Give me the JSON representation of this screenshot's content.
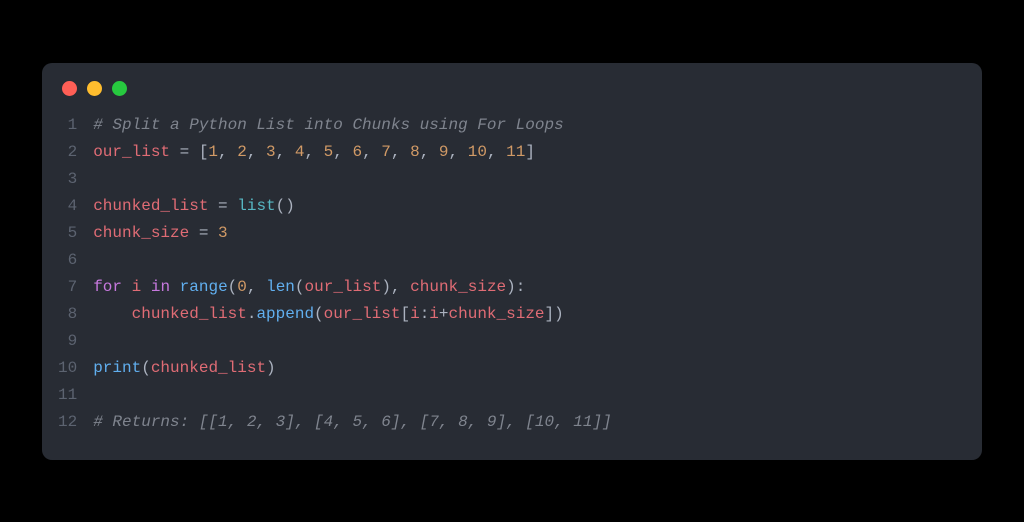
{
  "window": {
    "dots": [
      "red",
      "yellow",
      "green"
    ]
  },
  "code": {
    "line_numbers": [
      "1",
      "2",
      "3",
      "4",
      "5",
      "6",
      "7",
      "8",
      "9",
      "10",
      "11",
      "12"
    ],
    "lines": [
      [
        {
          "t": "# Split a Python List into Chunks using For Loops",
          "c": "c-comment"
        }
      ],
      [
        {
          "t": "our_list",
          "c": "c-id"
        },
        {
          "t": " = [",
          "c": "c-op"
        },
        {
          "t": "1",
          "c": "c-num"
        },
        {
          "t": ", ",
          "c": "c-punc"
        },
        {
          "t": "2",
          "c": "c-num"
        },
        {
          "t": ", ",
          "c": "c-punc"
        },
        {
          "t": "3",
          "c": "c-num"
        },
        {
          "t": ", ",
          "c": "c-punc"
        },
        {
          "t": "4",
          "c": "c-num"
        },
        {
          "t": ", ",
          "c": "c-punc"
        },
        {
          "t": "5",
          "c": "c-num"
        },
        {
          "t": ", ",
          "c": "c-punc"
        },
        {
          "t": "6",
          "c": "c-num"
        },
        {
          "t": ", ",
          "c": "c-punc"
        },
        {
          "t": "7",
          "c": "c-num"
        },
        {
          "t": ", ",
          "c": "c-punc"
        },
        {
          "t": "8",
          "c": "c-num"
        },
        {
          "t": ", ",
          "c": "c-punc"
        },
        {
          "t": "9",
          "c": "c-num"
        },
        {
          "t": ", ",
          "c": "c-punc"
        },
        {
          "t": "10",
          "c": "c-num"
        },
        {
          "t": ", ",
          "c": "c-punc"
        },
        {
          "t": "11",
          "c": "c-num"
        },
        {
          "t": "]",
          "c": "c-punc"
        }
      ],
      [],
      [
        {
          "t": "chunked_list",
          "c": "c-id"
        },
        {
          "t": " = ",
          "c": "c-op"
        },
        {
          "t": "list",
          "c": "c-builtin"
        },
        {
          "t": "()",
          "c": "c-punc"
        }
      ],
      [
        {
          "t": "chunk_size",
          "c": "c-id"
        },
        {
          "t": " = ",
          "c": "c-op"
        },
        {
          "t": "3",
          "c": "c-num"
        }
      ],
      [],
      [
        {
          "t": "for",
          "c": "c-kw"
        },
        {
          "t": " ",
          "c": ""
        },
        {
          "t": "i",
          "c": "c-id"
        },
        {
          "t": " ",
          "c": ""
        },
        {
          "t": "in",
          "c": "c-kw"
        },
        {
          "t": " ",
          "c": ""
        },
        {
          "t": "range",
          "c": "c-fn"
        },
        {
          "t": "(",
          "c": "c-punc"
        },
        {
          "t": "0",
          "c": "c-num"
        },
        {
          "t": ", ",
          "c": "c-punc"
        },
        {
          "t": "len",
          "c": "c-fn"
        },
        {
          "t": "(",
          "c": "c-punc"
        },
        {
          "t": "our_list",
          "c": "c-id"
        },
        {
          "t": "), ",
          "c": "c-punc"
        },
        {
          "t": "chunk_size",
          "c": "c-id"
        },
        {
          "t": "):",
          "c": "c-punc"
        }
      ],
      [
        {
          "t": "    ",
          "c": ""
        },
        {
          "t": "chunked_list",
          "c": "c-id"
        },
        {
          "t": ".",
          "c": "c-punc"
        },
        {
          "t": "append",
          "c": "c-fn"
        },
        {
          "t": "(",
          "c": "c-punc"
        },
        {
          "t": "our_list",
          "c": "c-id"
        },
        {
          "t": "[",
          "c": "c-punc"
        },
        {
          "t": "i",
          "c": "c-id"
        },
        {
          "t": ":",
          "c": "c-punc"
        },
        {
          "t": "i",
          "c": "c-id"
        },
        {
          "t": "+",
          "c": "c-op"
        },
        {
          "t": "chunk_size",
          "c": "c-id"
        },
        {
          "t": "])",
          "c": "c-punc"
        }
      ],
      [],
      [
        {
          "t": "print",
          "c": "c-fn"
        },
        {
          "t": "(",
          "c": "c-punc"
        },
        {
          "t": "chunked_list",
          "c": "c-id"
        },
        {
          "t": ")",
          "c": "c-punc"
        }
      ],
      [],
      [
        {
          "t": "# Returns: [[1, 2, 3], [4, 5, 6], [7, 8, 9], [10, 11]]",
          "c": "c-comment"
        }
      ]
    ]
  }
}
